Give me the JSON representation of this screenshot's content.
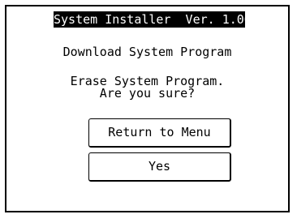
{
  "window": {
    "title": "System Installer  Ver. 1.00"
  },
  "dialog": {
    "subtitle": "Download System Program",
    "message_line1": "Erase System Program.",
    "message_line2": "Are you sure?"
  },
  "buttons": {
    "return_label": "Return to Menu",
    "yes_label": "Yes"
  },
  "colors": {
    "title_bg": "#000000",
    "title_fg": "#ffffff",
    "background": "#ffffff",
    "border": "#000000"
  }
}
